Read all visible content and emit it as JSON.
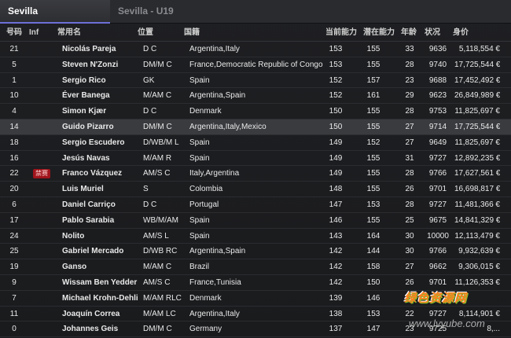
{
  "tabs": [
    {
      "label": "Sevilla"
    },
    {
      "label": "Sevilla - U19"
    }
  ],
  "columns": {
    "no": "号码",
    "inf": "Inf",
    "name": "常用名",
    "position": "位置",
    "nationality": "国籍",
    "current_ability": "当前能力",
    "potential_ability": "潜在能力",
    "age": "年龄",
    "condition": "状况",
    "value": "身价"
  },
  "rows": [
    {
      "no": "21",
      "inf": "",
      "name": "Nicolás Pareja",
      "position": "D C",
      "nationality": "Argentina,Italy",
      "ca": "153",
      "pa": "155",
      "age": "33",
      "condition": "9636",
      "value": "5,118,554 €"
    },
    {
      "no": "5",
      "inf": "",
      "name": "Steven N'Zonzi",
      "position": "DM/M C",
      "nationality": "France,Democratic Republic of Congo",
      "ca": "153",
      "pa": "155",
      "age": "28",
      "condition": "9740",
      "value": "17,725,544 €"
    },
    {
      "no": "1",
      "inf": "",
      "name": "Sergio Rico",
      "position": "GK",
      "nationality": "Spain",
      "ca": "152",
      "pa": "157",
      "age": "23",
      "condition": "9688",
      "value": "17,452,492 €"
    },
    {
      "no": "10",
      "inf": "",
      "name": "Éver Banega",
      "position": "M/AM C",
      "nationality": "Argentina,Spain",
      "ca": "152",
      "pa": "161",
      "age": "29",
      "condition": "9623",
      "value": "26,849,989 €"
    },
    {
      "no": "4",
      "inf": "",
      "name": "Simon Kjær",
      "position": "D C",
      "nationality": "Denmark",
      "ca": "150",
      "pa": "155",
      "age": "28",
      "condition": "9753",
      "value": "11,825,697 €"
    },
    {
      "no": "14",
      "inf": "",
      "name": "Guido Pizarro",
      "position": "DM/M C",
      "nationality": "Argentina,Italy,Mexico",
      "ca": "150",
      "pa": "155",
      "age": "27",
      "condition": "9714",
      "value": "17,725,544 €"
    },
    {
      "no": "18",
      "inf": "",
      "name": "Sergio Escudero",
      "position": "D/WB/M L",
      "nationality": "Spain",
      "ca": "149",
      "pa": "152",
      "age": "27",
      "condition": "9649",
      "value": "11,825,697 €"
    },
    {
      "no": "16",
      "inf": "",
      "name": "Jesús Navas",
      "position": "M/AM R",
      "nationality": "Spain",
      "ca": "149",
      "pa": "155",
      "age": "31",
      "condition": "9727",
      "value": "12,892,235 €"
    },
    {
      "no": "22",
      "inf": "禁赛",
      "name": "Franco Vázquez",
      "position": "AM/S C",
      "nationality": "Italy,Argentina",
      "ca": "149",
      "pa": "155",
      "age": "28",
      "condition": "9766",
      "value": "17,627,561 €"
    },
    {
      "no": "20",
      "inf": "",
      "name": "Luis Muriel",
      "position": "S",
      "nationality": "Colombia",
      "ca": "148",
      "pa": "155",
      "age": "26",
      "condition": "9701",
      "value": "16,698,817 €"
    },
    {
      "no": "6",
      "inf": "",
      "name": "Daniel Carriço",
      "position": "D C",
      "nationality": "Portugal",
      "ca": "147",
      "pa": "153",
      "age": "28",
      "condition": "9727",
      "value": "11,481,366 €"
    },
    {
      "no": "17",
      "inf": "",
      "name": "Pablo Sarabia",
      "position": "WB/M/AM",
      "nationality": "Spain",
      "ca": "146",
      "pa": "155",
      "age": "25",
      "condition": "9675",
      "value": "14,841,329 €"
    },
    {
      "no": "24",
      "inf": "",
      "name": "Nolito",
      "position": "AM/S L",
      "nationality": "Spain",
      "ca": "143",
      "pa": "164",
      "age": "30",
      "condition": "10000",
      "value": "12,113,479 €"
    },
    {
      "no": "25",
      "inf": "",
      "name": "Gabriel Mercado",
      "position": "D/WB RC",
      "nationality": "Argentina,Spain",
      "ca": "142",
      "pa": "144",
      "age": "30",
      "condition": "9766",
      "value": "9,932,639 €"
    },
    {
      "no": "19",
      "inf": "",
      "name": "Ganso",
      "position": "M/AM C",
      "nationality": "Brazil",
      "ca": "142",
      "pa": "158",
      "age": "27",
      "condition": "9662",
      "value": "9,306,015 €"
    },
    {
      "no": "9",
      "inf": "",
      "name": "Wissam Ben Yedder",
      "position": "AM/S C",
      "nationality": "France,Tunisia",
      "ca": "142",
      "pa": "150",
      "age": "26",
      "condition": "9701",
      "value": "11,126,353 €"
    },
    {
      "no": "7",
      "inf": "",
      "name": "Michael Krohn-Dehli",
      "position": "M/AM RLC",
      "nationality": "Denmark",
      "ca": "139",
      "pa": "146",
      "age": "",
      "condition": "",
      "value": ""
    },
    {
      "no": "11",
      "inf": "",
      "name": "Joaquín Correa",
      "position": "M/AM LC",
      "nationality": "Argentina,Italy",
      "ca": "138",
      "pa": "153",
      "age": "22",
      "condition": "9727",
      "value": "8,114,901 €"
    },
    {
      "no": "0",
      "inf": "",
      "name": "Johannes Geis",
      "position": "DM/M C",
      "nationality": "Germany",
      "ca": "137",
      "pa": "147",
      "age": "23",
      "condition": "9725",
      "value": "8,..."
    }
  ],
  "highlighted_row_index": 5,
  "watermark": {
    "line1": "绿色资源网",
    "line2": "www.lvyube.com"
  },
  "colors": {
    "background": "#1f2023",
    "tab_active_underline": "#6b6fd6",
    "row_highlight": "#3a3b3f",
    "badge_red": "#a0141b"
  }
}
